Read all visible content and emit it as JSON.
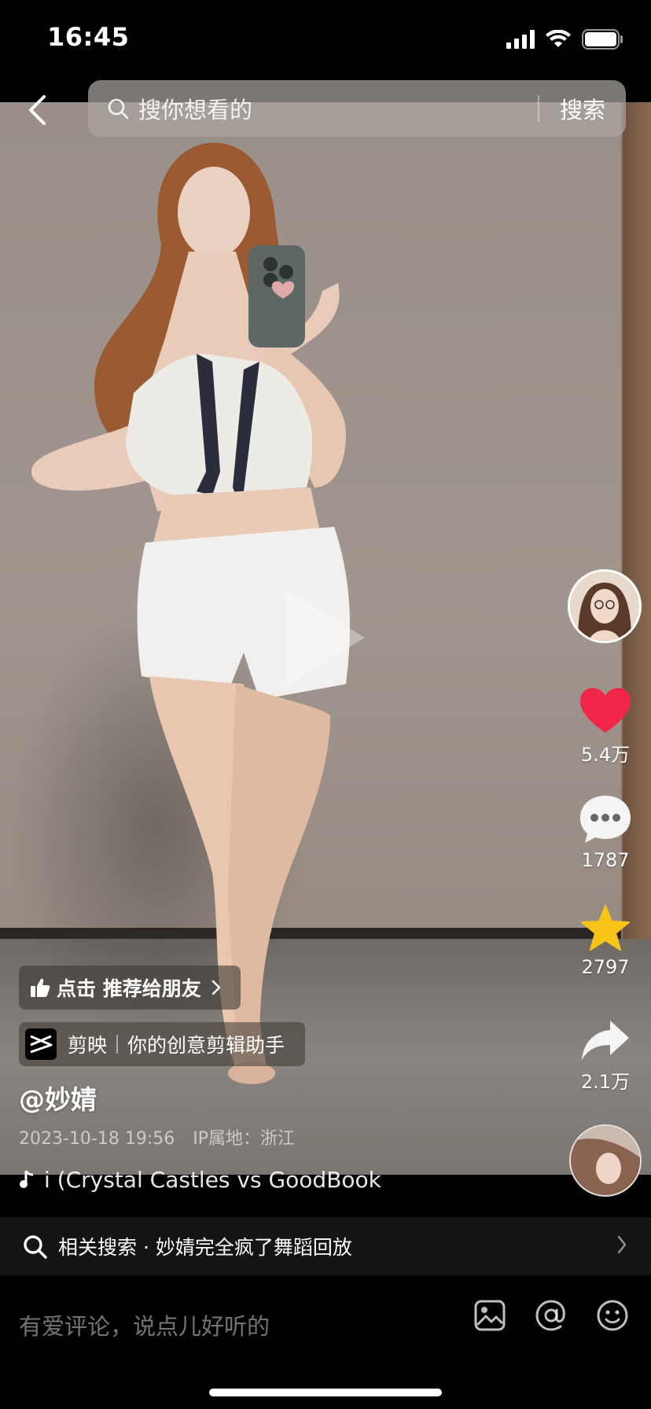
{
  "status_bar": {
    "time": "16:45"
  },
  "search": {
    "placeholder": "搜你想看的",
    "submit_label": "搜索"
  },
  "rail": {
    "likes": "5.4万",
    "comments": "1787",
    "favorites": "2797",
    "shares": "2.1万"
  },
  "overlay": {
    "recommend_label": "点击 推荐给朋友",
    "capcut_name": "剪映",
    "capcut_slogan": "你的创意剪辑助手",
    "author": "@妙婧",
    "date": "2023-10-18 19:56",
    "ip_location": "IP属地：浙江",
    "music": "i (Crystal Castles vs GoodBook"
  },
  "related": {
    "label": "相关搜索 · 妙婧完全疯了舞蹈回放"
  },
  "comment": {
    "placeholder": "有爱评论，说点儿好听的"
  },
  "colors": {
    "like": "#f1264a",
    "favorite": "#f8c418",
    "background": "#000000"
  },
  "icons": [
    "back-icon",
    "search-icon",
    "heart-icon",
    "comment-bubble-icon",
    "star-icon",
    "share-icon",
    "thumbs-up-icon",
    "chevron-right-icon",
    "capcut-icon",
    "music-note-icon",
    "image-icon",
    "at-icon",
    "emoji-icon"
  ]
}
